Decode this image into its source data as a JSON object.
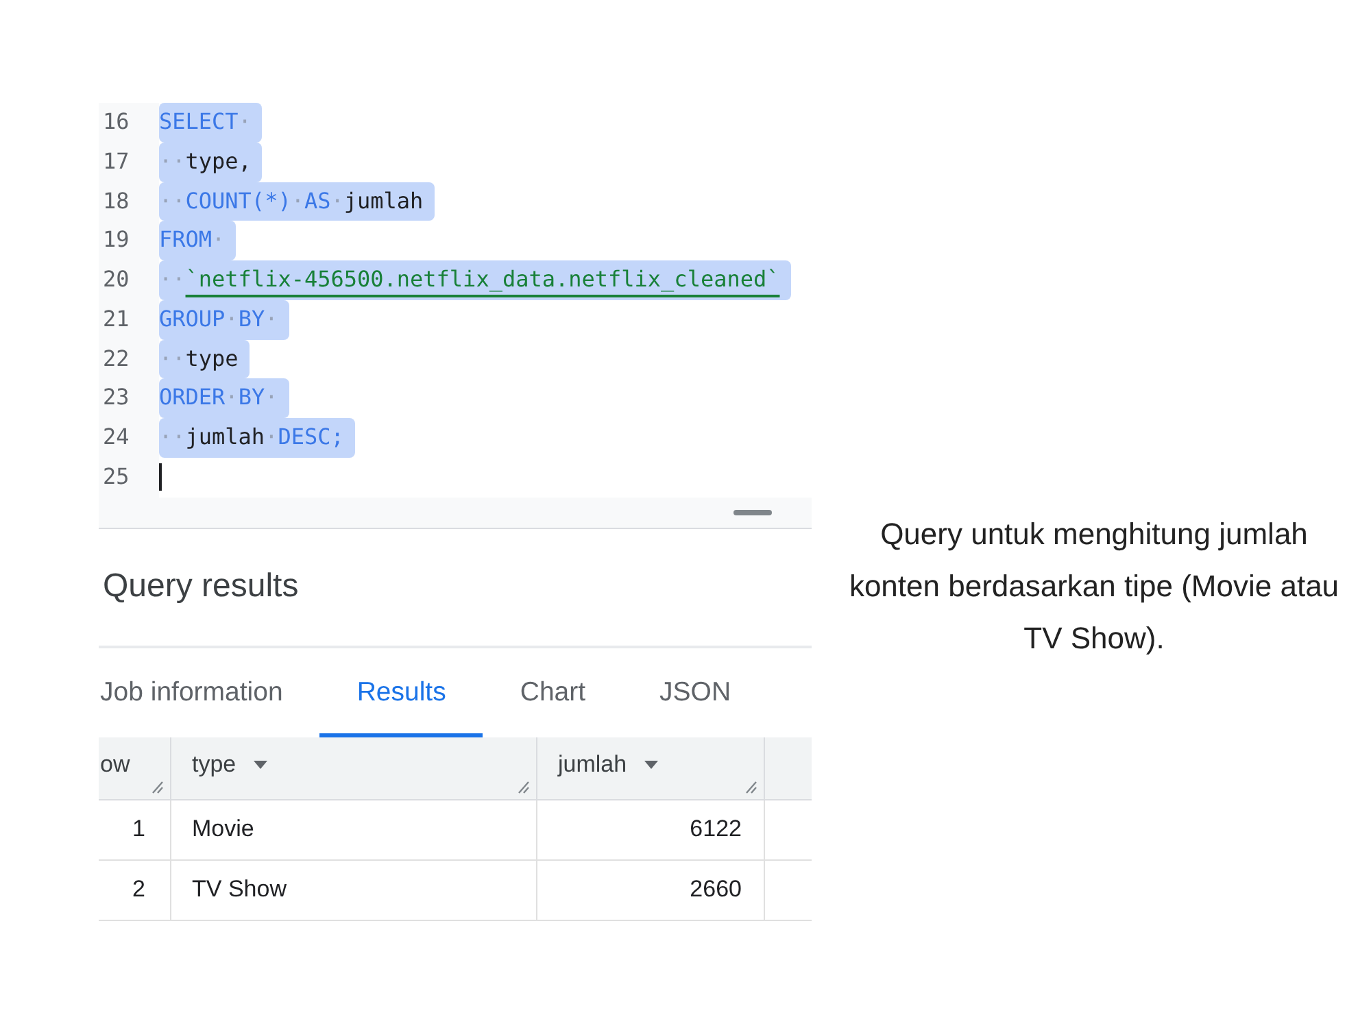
{
  "editor": {
    "lines": [
      {
        "number": "16",
        "selected": true,
        "cursor": false,
        "tokens": [
          {
            "kind": "keyword",
            "text": "SELECT"
          },
          {
            "kind": "space",
            "text": "·"
          }
        ]
      },
      {
        "number": "17",
        "selected": true,
        "cursor": false,
        "tokens": [
          {
            "kind": "space",
            "text": "··"
          },
          {
            "kind": "identifier",
            "text": "type,"
          }
        ]
      },
      {
        "number": "18",
        "selected": true,
        "cursor": false,
        "tokens": [
          {
            "kind": "space",
            "text": "··"
          },
          {
            "kind": "keyword",
            "text": "COUNT(*)"
          },
          {
            "kind": "space",
            "text": "·"
          },
          {
            "kind": "keyword",
            "text": "AS"
          },
          {
            "kind": "space",
            "text": "·"
          },
          {
            "kind": "identifier",
            "text": "jumlah"
          }
        ]
      },
      {
        "number": "19",
        "selected": true,
        "cursor": false,
        "tokens": [
          {
            "kind": "keyword",
            "text": "FROM"
          },
          {
            "kind": "space",
            "text": "·"
          }
        ]
      },
      {
        "number": "20",
        "selected": true,
        "cursor": false,
        "tokens": [
          {
            "kind": "space",
            "text": "··"
          },
          {
            "kind": "string",
            "text": "`netflix-456500.netflix_data.netflix_cleaned`"
          }
        ]
      },
      {
        "number": "21",
        "selected": true,
        "cursor": false,
        "tokens": [
          {
            "kind": "keyword",
            "text": "GROUP"
          },
          {
            "kind": "space",
            "text": "·"
          },
          {
            "kind": "keyword",
            "text": "BY"
          },
          {
            "kind": "space",
            "text": "·"
          }
        ]
      },
      {
        "number": "22",
        "selected": true,
        "cursor": false,
        "tokens": [
          {
            "kind": "space",
            "text": "··"
          },
          {
            "kind": "identifier",
            "text": "type"
          }
        ]
      },
      {
        "number": "23",
        "selected": true,
        "cursor": false,
        "tokens": [
          {
            "kind": "keyword",
            "text": "ORDER"
          },
          {
            "kind": "space",
            "text": "·"
          },
          {
            "kind": "keyword",
            "text": "BY"
          },
          {
            "kind": "space",
            "text": "·"
          }
        ]
      },
      {
        "number": "24",
        "selected": true,
        "cursor": false,
        "tokens": [
          {
            "kind": "space",
            "text": "··"
          },
          {
            "kind": "identifier",
            "text": "jumlah"
          },
          {
            "kind": "space",
            "text": "·"
          },
          {
            "kind": "keyword",
            "text": "DESC;"
          }
        ]
      },
      {
        "number": "25",
        "selected": false,
        "cursor": true
      }
    ]
  },
  "results_panel": {
    "title": "Query results",
    "tabs": [
      {
        "label": "Job information",
        "selected": false
      },
      {
        "label": "Results",
        "selected": true
      },
      {
        "label": "Chart",
        "selected": false
      },
      {
        "label": "JSON",
        "selected": false
      }
    ],
    "table": {
      "columns": [
        {
          "label": "ow",
          "kind": "index",
          "menu": false
        },
        {
          "label": "type",
          "kind": "text",
          "menu": true
        },
        {
          "label": "jumlah",
          "kind": "number",
          "menu": true
        }
      ],
      "rows": [
        {
          "cells": [
            "1",
            "Movie",
            "6122"
          ]
        },
        {
          "cells": [
            "2",
            "TV Show",
            "2660"
          ]
        }
      ]
    }
  },
  "caption": "Query untuk menghitung jumlah konten berdasarkan tipe (Movie atau TV Show)."
}
